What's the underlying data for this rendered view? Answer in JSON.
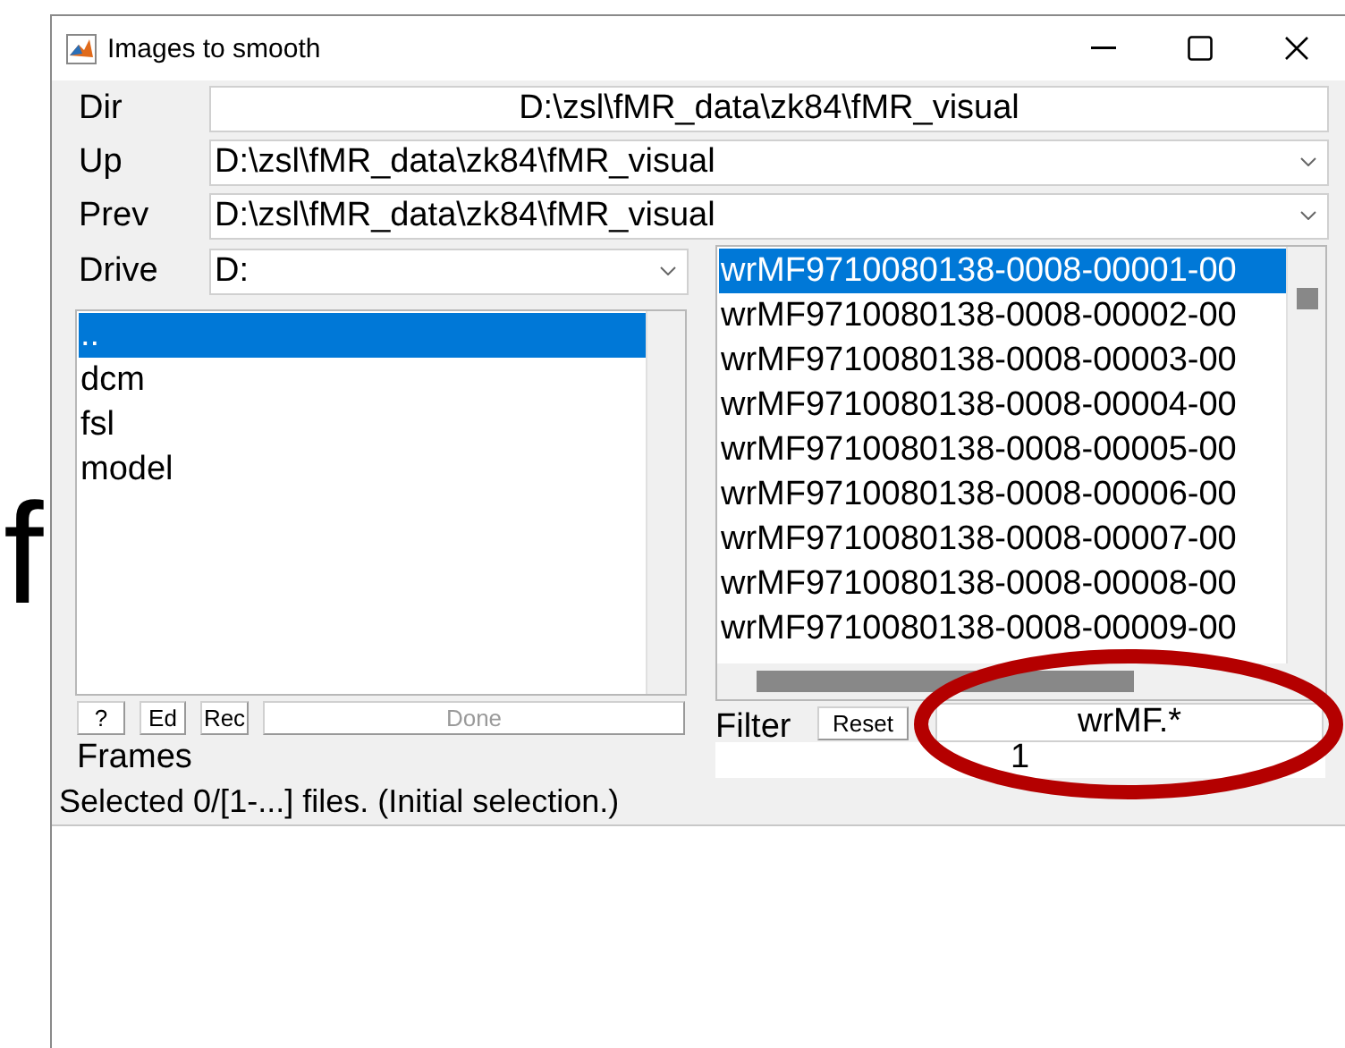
{
  "background_text": "f",
  "window": {
    "title": "Images to smooth"
  },
  "dir": {
    "label": "Dir",
    "value": "D:\\zsl\\fMR_data\\zk84\\fMR_visual"
  },
  "up": {
    "label": "Up",
    "value": "D:\\zsl\\fMR_data\\zk84\\fMR_visual"
  },
  "prev": {
    "label": "Prev",
    "value": "D:\\zsl\\fMR_data\\zk84\\fMR_visual"
  },
  "drive": {
    "label": "Drive",
    "value": "D:"
  },
  "directories": [
    {
      "name": "..",
      "selected": true
    },
    {
      "name": "dcm",
      "selected": false
    },
    {
      "name": "fsl",
      "selected": false
    },
    {
      "name": "model",
      "selected": false
    }
  ],
  "buttons": [
    {
      "label": "?",
      "disabled": false
    },
    {
      "label": "Ed",
      "disabled": false
    },
    {
      "label": "Rec",
      "disabled": false
    },
    {
      "label": "Done",
      "disabled": true
    }
  ],
  "files": [
    {
      "name": "wrMF9710080138-0008-00001-00",
      "selected": true
    },
    {
      "name": "wrMF9710080138-0008-00002-00",
      "selected": false
    },
    {
      "name": "wrMF9710080138-0008-00003-00",
      "selected": false
    },
    {
      "name": "wrMF9710080138-0008-00004-00",
      "selected": false
    },
    {
      "name": "wrMF9710080138-0008-00005-00",
      "selected": false
    },
    {
      "name": "wrMF9710080138-0008-00006-00",
      "selected": false
    },
    {
      "name": "wrMF9710080138-0008-00007-00",
      "selected": false
    },
    {
      "name": "wrMF9710080138-0008-00008-00",
      "selected": false
    },
    {
      "name": "wrMF9710080138-0008-00009-00",
      "selected": false
    }
  ],
  "filter": {
    "label": "Filter",
    "reset": "Reset",
    "value": "wrMF.*"
  },
  "frames": {
    "label": "Frames",
    "value": "1"
  },
  "status": "Selected 0/[1-...] files. (Initial selection.)",
  "annotation": {
    "kind": "ellipse"
  }
}
